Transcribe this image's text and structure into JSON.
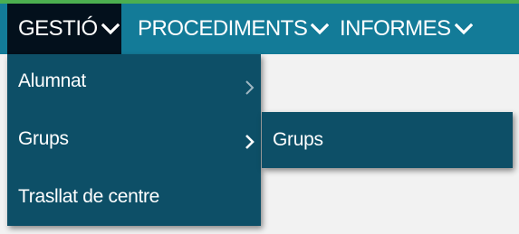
{
  "nav": {
    "items": [
      {
        "label": "GESTIÓ",
        "icon": "chevron-down-icon",
        "active": true
      },
      {
        "label": "PROCEDIMENTS",
        "icon": "chevron-down-icon",
        "active": false
      },
      {
        "label": "INFORMES",
        "icon": "chevron-down-icon",
        "active": false
      }
    ]
  },
  "menu": {
    "items": [
      {
        "label": "Alumnat",
        "icon": "chevron-right-icon"
      },
      {
        "label": "Grups",
        "icon": "chevron-right-icon"
      },
      {
        "label": "Trasllat de centre"
      }
    ]
  },
  "submenu": {
    "items": [
      {
        "label": "Grups"
      }
    ]
  },
  "colors": {
    "navbar": "#137b98",
    "nav_active": "#03101c",
    "menu": "#0d4f67",
    "top_accent": "#4caf50",
    "text": "#ffffff"
  }
}
